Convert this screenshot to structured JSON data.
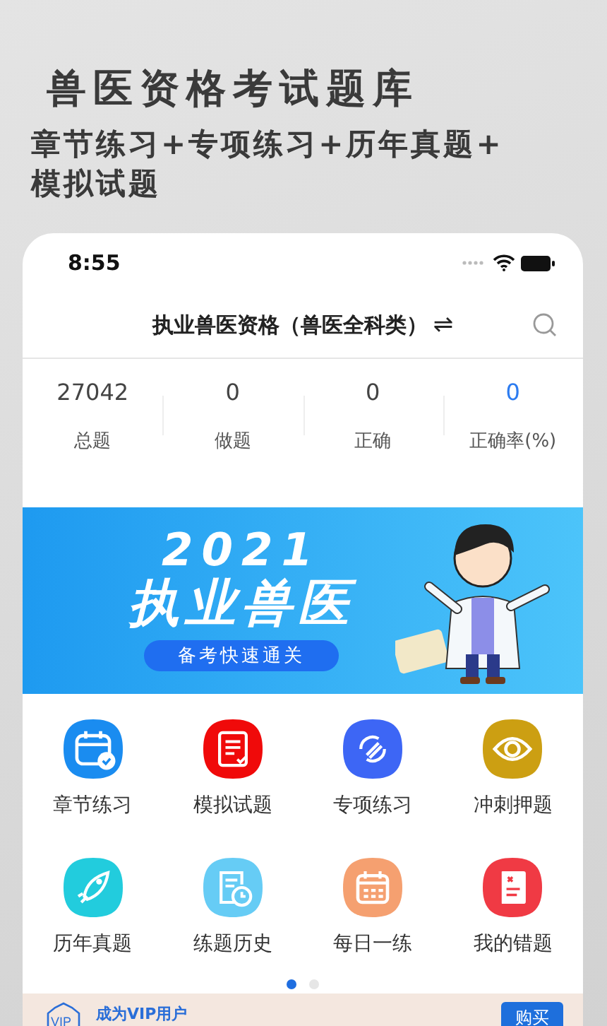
{
  "header": {
    "title": "兽医资格考试题库",
    "subtitle_lines": [
      "章节练习+专项练习+历年真题+",
      "模拟试题"
    ]
  },
  "status_bar": {
    "time": "8:55"
  },
  "nav": {
    "title": "执业兽医资格（兽医全科类）",
    "switch_icon": "⇌"
  },
  "stats": [
    {
      "value": "27042",
      "label": "总题",
      "highlight": false
    },
    {
      "value": "0",
      "label": "做题",
      "highlight": false
    },
    {
      "value": "0",
      "label": "正确",
      "highlight": false
    },
    {
      "value": "0",
      "label": "正确率(%)",
      "highlight": true
    }
  ],
  "banner": {
    "year": "2021",
    "headline": "执业兽医",
    "tagline": "备考快速通关"
  },
  "menu": [
    {
      "label": "章节练习",
      "kind": "calendar-check",
      "color": "#1a8cf0"
    },
    {
      "label": "模拟试题",
      "kind": "document",
      "color": "#f00a0a"
    },
    {
      "label": "专项练习",
      "kind": "swap",
      "color": "#3d66f5"
    },
    {
      "label": "冲刺押题",
      "kind": "eye",
      "color": "#cc9f12"
    },
    {
      "label": "历年真题",
      "kind": "rocket",
      "color": "#22ccdd"
    },
    {
      "label": "练题历史",
      "kind": "history",
      "color": "#66ccf5"
    },
    {
      "label": "每日一练",
      "kind": "calendar",
      "color": "#f5a070"
    },
    {
      "label": "我的错题",
      "kind": "book",
      "color": "#f03a44"
    }
  ],
  "pager": [
    {
      "selected": true
    },
    {
      "selected": false
    }
  ],
  "vip": {
    "badge": "VIP",
    "title": "成为VIP用户",
    "button": "购买"
  }
}
